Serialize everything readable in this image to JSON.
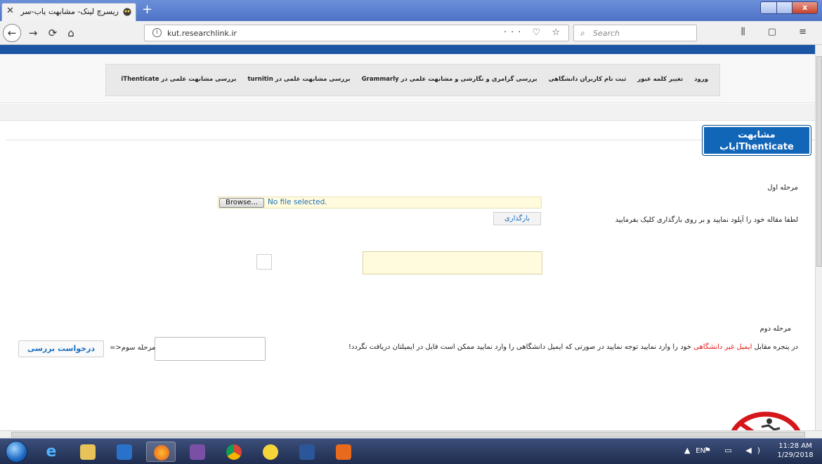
{
  "browser": {
    "tab_title": "ریسرچ لینک- مشابهت یاب-سرقت علمی",
    "tab_close": "✕",
    "new_tab": "+",
    "url_info": "i",
    "url": "kut.researchlink.ir",
    "url_actions": "··· ♡ ☆",
    "search_placeholder": "Search",
    "window_close": "x",
    "back": "←",
    "forward": "→",
    "reload": "⟳",
    "home": "⌂",
    "search_icon": "⌕",
    "toolbar_right": "⫼ ▢ ≡"
  },
  "menu": {
    "items": [
      "بررسی مشابهت علمی در iThenticate",
      "بررسی مشابهت علمی در turnitin",
      "بررسی گرامری و نگارشی و مشابهت علمی در Grammarly",
      "ثبت نام کاربران دانشگاهی",
      "تغییر کلمه عبور",
      "ورود"
    ]
  },
  "badge": {
    "line1": "مشابهت",
    "line2": "یابiThenticate"
  },
  "step1": {
    "title": "مرحله اول",
    "instruction": "لطفا مقاله خود را آپلود نمایید و بر روی بارگذاری کلیک بفرمایید",
    "browse_label": "Browse...",
    "file_status": "No file selected.",
    "upload_label": "بارگذاری"
  },
  "step2": {
    "title": "مرحله دوم",
    "instruction_before": "در پنجره مقابل ",
    "instruction_highlight": "ایمیل غیر دانشگاهی",
    "instruction_after": " خود را وارد نمایید توجه نمایید در صورتی که ایمیل دانشگاهی را وارد نمایید ممکن است فایل در ایمیلتان دریافت نگردد!",
    "email_value": ""
  },
  "step3": {
    "title": "مرحله سوم<=",
    "submit_label": "درخواست بررسی"
  },
  "taskbar": {
    "lang": "EN",
    "tray_icons": "▲ ⚑ ▭ ◀)",
    "time": "11:28 AM",
    "date": "1/29/2018"
  },
  "colors": {
    "brand_blue": "#1266b8",
    "top_strip": "#1b56a5",
    "link_blue": "#1c6fc0",
    "highlight_red": "#e2201d",
    "field_yellow": "#fffbdc"
  }
}
